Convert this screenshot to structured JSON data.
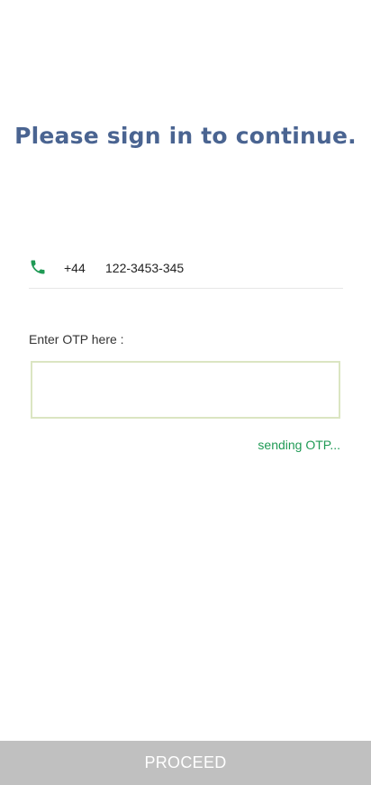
{
  "header": {
    "title": "Please sign in to continue."
  },
  "phone": {
    "icon": "phone-icon",
    "icon_color": "#1f9a55",
    "country_code": "+44",
    "number": "122-3453-345"
  },
  "otp": {
    "label": "Enter OTP here :",
    "value": "",
    "placeholder": "",
    "status": "sending OTP..."
  },
  "footer": {
    "proceed_label": "PROCEED"
  },
  "colors": {
    "title": "#4a6491",
    "accent_green": "#1f9a55",
    "otp_border": "#dbe5c2",
    "button_disabled": "#c0c0c0"
  }
}
